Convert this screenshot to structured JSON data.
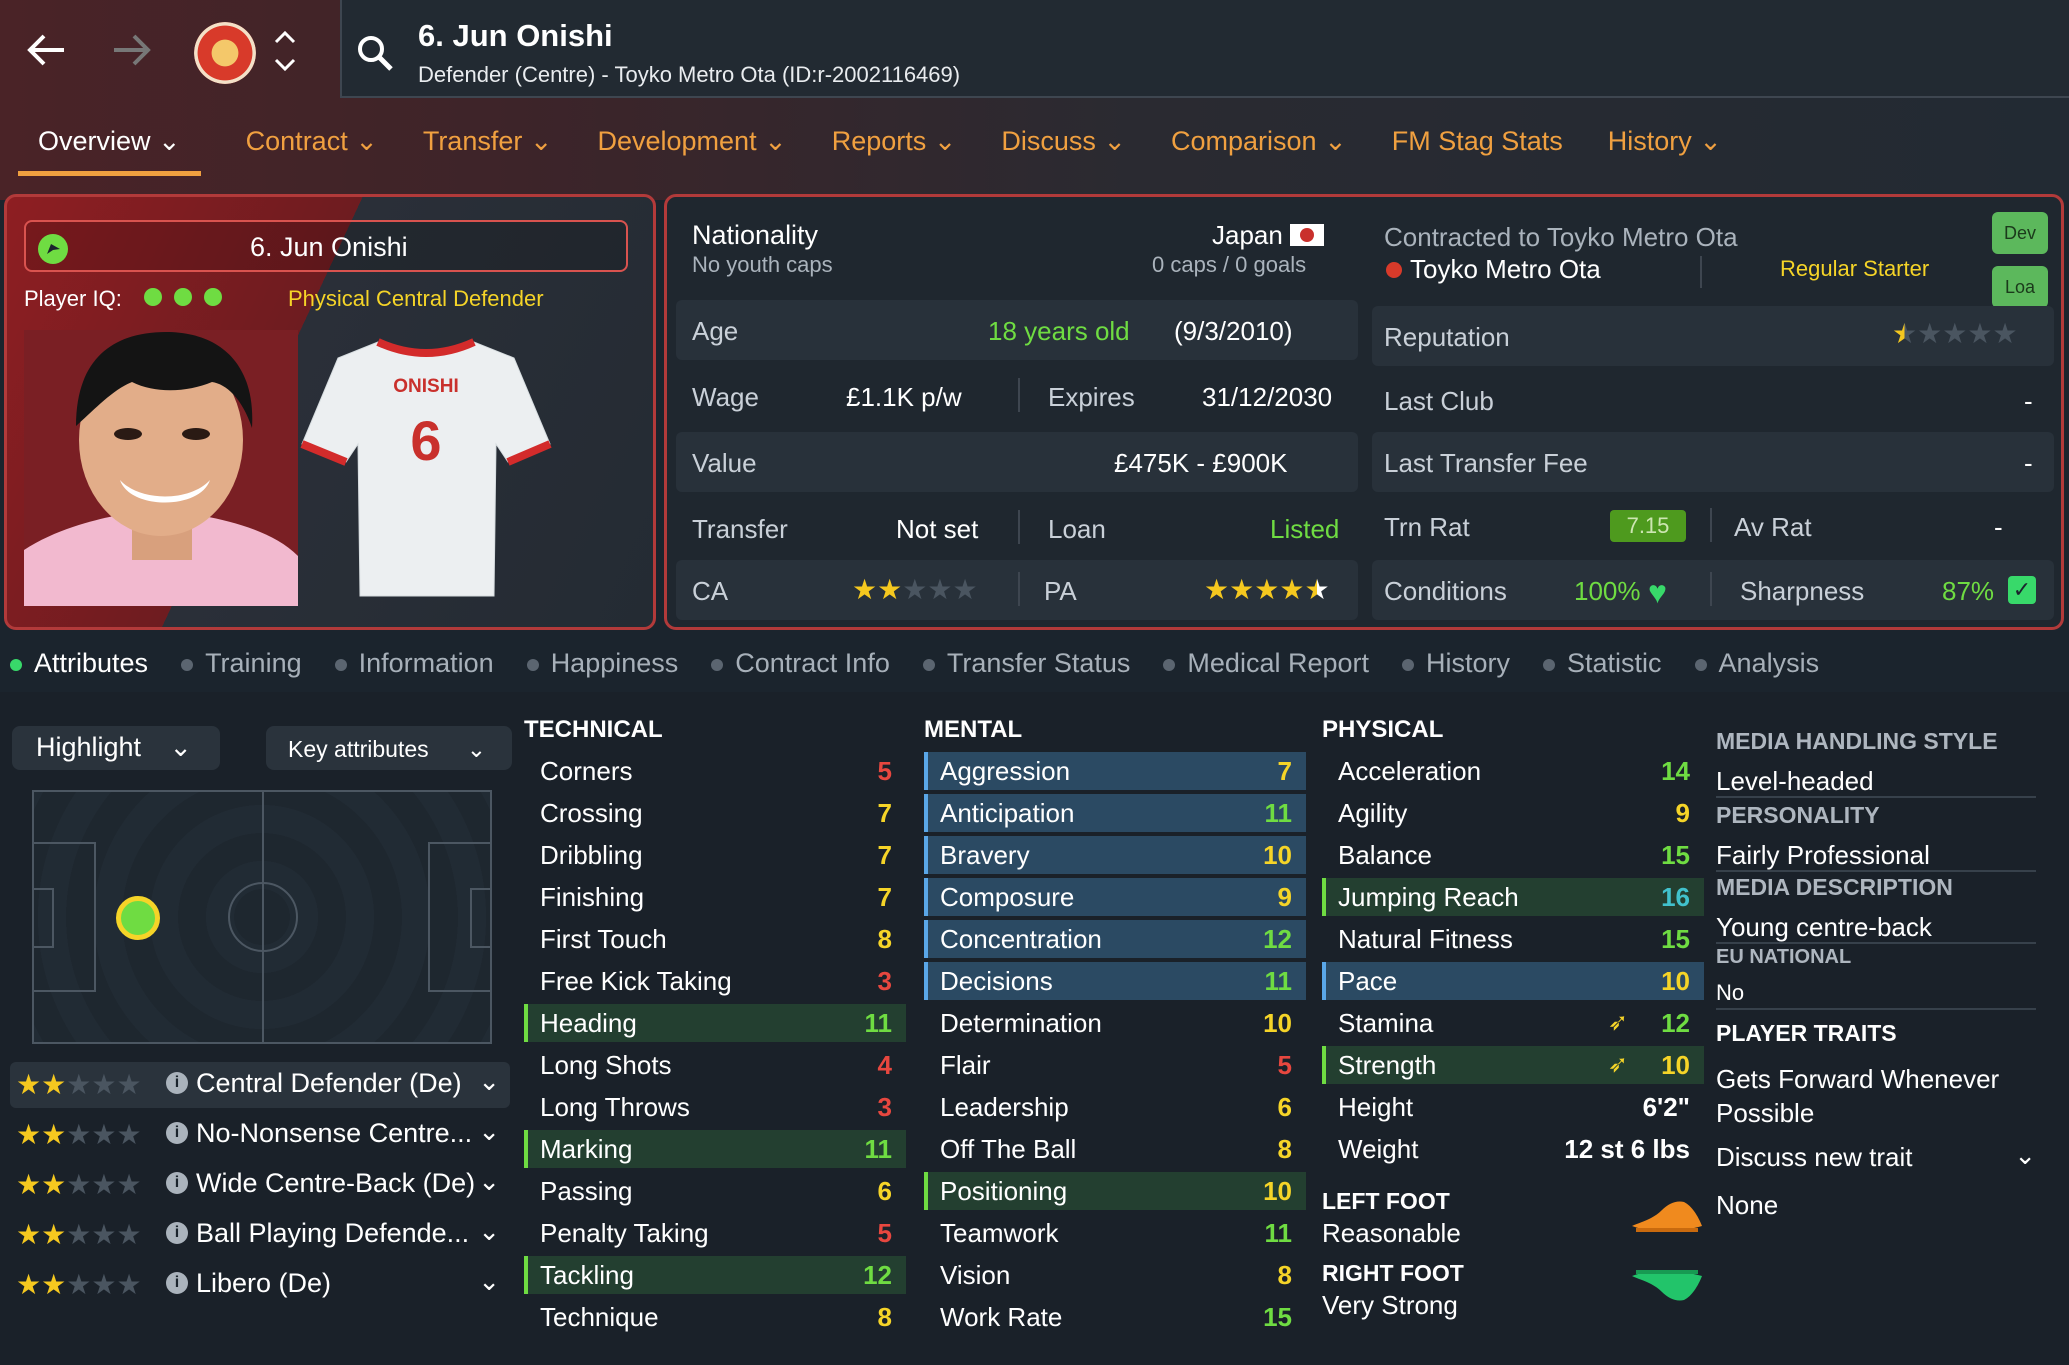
{
  "header": {
    "player_title": "6. Jun Onishi",
    "subtitle": "Defender (Centre) - Toyko Metro Ota (ID:r-2002116469)",
    "back_icon": "arrow-left-icon",
    "forward_icon": "arrow-right-icon",
    "search_icon": "search-icon"
  },
  "tabs": [
    {
      "label": "Overview"
    },
    {
      "label": "Contract"
    },
    {
      "label": "Transfer"
    },
    {
      "label": "Development"
    },
    {
      "label": "Reports"
    },
    {
      "label": "Discuss"
    },
    {
      "label": "Comparison"
    },
    {
      "label": "FM Stag Stats"
    },
    {
      "label": "History"
    }
  ],
  "profile": {
    "name": "6. Jun Onishi",
    "iq_label": "Player IQ:",
    "role_desc": "Physical Central Defender",
    "shirt_name": "ONISHI",
    "shirt_number": "6"
  },
  "info": {
    "nationality_label": "Nationality",
    "youth_caps": "No youth caps",
    "country": "Japan",
    "caps": "0 caps / 0 goals",
    "age_label": "Age",
    "age": "18 years old",
    "dob": "(9/3/2010)",
    "wage_label": "Wage",
    "wage": "£1.1K p/w",
    "expires_label": "Expires",
    "expires": "31/12/2030",
    "value_label": "Value",
    "value": "£475K - £900K",
    "transfer_label": "Transfer",
    "transfer": "Not set",
    "loan_label": "Loan",
    "loan": "Listed",
    "ca_label": "CA",
    "pa_label": "PA",
    "ca_stars": 2,
    "pa_stars": 4.5
  },
  "club": {
    "contracted": "Contracted to Toyko Metro Ota",
    "club_name": "Toyko Metro Ota",
    "status": "Regular Starter",
    "dev_btn": "Dev",
    "loa_btn": "Loa",
    "reputation_label": "Reputation",
    "reputation_stars": 0.5,
    "last_club_label": "Last Club",
    "last_club": "-",
    "last_fee_label": "Last Transfer Fee",
    "last_fee": "-",
    "trn_label": "Trn Rat",
    "trn_val": "7.15",
    "av_label": "Av Rat",
    "av_val": "-",
    "cond_label": "Conditions",
    "cond_val": "100%",
    "sharp_label": "Sharpness",
    "sharp_val": "87%"
  },
  "subtabs": [
    {
      "label": "Attributes"
    },
    {
      "label": "Training"
    },
    {
      "label": "Information"
    },
    {
      "label": "Happiness"
    },
    {
      "label": "Contract Info"
    },
    {
      "label": "Transfer Status"
    },
    {
      "label": "Medical Report"
    },
    {
      "label": "History"
    },
    {
      "label": "Statistic"
    },
    {
      "label": "Analysis"
    }
  ],
  "controls": {
    "highlight": "Highlight",
    "key_attributes": "Key attributes"
  },
  "roles": [
    {
      "label": "Central Defender (De)",
      "stars": 2
    },
    {
      "label": "No-Nonsense Centre...",
      "stars": 2
    },
    {
      "label": "Wide Centre-Back (De)",
      "stars": 2
    },
    {
      "label": "Ball Playing Defende...",
      "stars": 2
    },
    {
      "label": "Libero (De)",
      "stars": 2
    }
  ],
  "technical": {
    "title": "TECHNICAL",
    "items": [
      {
        "name": "Corners",
        "value": "5",
        "color": "red",
        "hl": ""
      },
      {
        "name": "Crossing",
        "value": "7",
        "color": "yel",
        "hl": ""
      },
      {
        "name": "Dribbling",
        "value": "7",
        "color": "yel",
        "hl": ""
      },
      {
        "name": "Finishing",
        "value": "7",
        "color": "yel",
        "hl": ""
      },
      {
        "name": "First Touch",
        "value": "8",
        "color": "yel",
        "hl": ""
      },
      {
        "name": "Free Kick Taking",
        "value": "3",
        "color": "red",
        "hl": ""
      },
      {
        "name": "Heading",
        "value": "11",
        "color": "grn",
        "hl": "g"
      },
      {
        "name": "Long Shots",
        "value": "4",
        "color": "red",
        "hl": ""
      },
      {
        "name": "Long Throws",
        "value": "3",
        "color": "red",
        "hl": ""
      },
      {
        "name": "Marking",
        "value": "11",
        "color": "grn",
        "hl": "g"
      },
      {
        "name": "Passing",
        "value": "6",
        "color": "yel",
        "hl": ""
      },
      {
        "name": "Penalty Taking",
        "value": "5",
        "color": "red",
        "hl": ""
      },
      {
        "name": "Tackling",
        "value": "12",
        "color": "grn",
        "hl": "g"
      },
      {
        "name": "Technique",
        "value": "8",
        "color": "yel",
        "hl": ""
      }
    ]
  },
  "mental": {
    "title": "MENTAL",
    "items": [
      {
        "name": "Aggression",
        "value": "7",
        "color": "yel",
        "hl": "b"
      },
      {
        "name": "Anticipation",
        "value": "11",
        "color": "grn",
        "hl": "b"
      },
      {
        "name": "Bravery",
        "value": "10",
        "color": "yel",
        "hl": "b"
      },
      {
        "name": "Composure",
        "value": "9",
        "color": "yel",
        "hl": "b"
      },
      {
        "name": "Concentration",
        "value": "12",
        "color": "grn",
        "hl": "b"
      },
      {
        "name": "Decisions",
        "value": "11",
        "color": "grn",
        "hl": "b"
      },
      {
        "name": "Determination",
        "value": "10",
        "color": "yel",
        "hl": ""
      },
      {
        "name": "Flair",
        "value": "5",
        "color": "red",
        "hl": ""
      },
      {
        "name": "Leadership",
        "value": "6",
        "color": "yel",
        "hl": ""
      },
      {
        "name": "Off The Ball",
        "value": "8",
        "color": "yel",
        "hl": ""
      },
      {
        "name": "Positioning",
        "value": "10",
        "color": "yel",
        "hl": "g"
      },
      {
        "name": "Teamwork",
        "value": "11",
        "color": "grn",
        "hl": ""
      },
      {
        "name": "Vision",
        "value": "8",
        "color": "yel",
        "hl": ""
      },
      {
        "name": "Work Rate",
        "value": "15",
        "color": "grn",
        "hl": ""
      }
    ]
  },
  "physical": {
    "title": "PHYSICAL",
    "items": [
      {
        "name": "Acceleration",
        "value": "14",
        "color": "grn",
        "hl": ""
      },
      {
        "name": "Agility",
        "value": "9",
        "color": "yel",
        "hl": ""
      },
      {
        "name": "Balance",
        "value": "15",
        "color": "grn",
        "hl": ""
      },
      {
        "name": "Jumping Reach",
        "value": "16",
        "color": "teal",
        "hl": "g"
      },
      {
        "name": "Natural Fitness",
        "value": "15",
        "color": "grn",
        "hl": ""
      },
      {
        "name": "Pace",
        "value": "10",
        "color": "yel",
        "hl": "b"
      },
      {
        "name": "Stamina",
        "value": "12",
        "color": "grn",
        "hl": "",
        "arrow": true
      },
      {
        "name": "Strength",
        "value": "10",
        "color": "yel",
        "hl": "g",
        "arrow": true
      },
      {
        "name": "Height",
        "value": "6'2\"",
        "color": "white",
        "hl": ""
      },
      {
        "name": "Weight",
        "value": "12 st 6 lbs",
        "color": "white",
        "hl": ""
      }
    ],
    "left_foot_label": "LEFT FOOT",
    "left_foot": "Reasonable",
    "right_foot_label": "RIGHT FOOT",
    "right_foot": "Very Strong"
  },
  "side": {
    "media_style_label": "MEDIA HANDLING STYLE",
    "media_style": "Level-headed",
    "personality_label": "PERSONALITY",
    "personality": "Fairly Professional",
    "media_desc_label": "MEDIA DESCRIPTION",
    "media_desc": "Young centre-back",
    "eu_label": "EU NATIONAL",
    "eu": "No",
    "traits_label": "PLAYER TRAITS",
    "trait_1": "Gets Forward Whenever",
    "trait_2": "Possible",
    "discuss": "Discuss new trait",
    "none": "None"
  }
}
